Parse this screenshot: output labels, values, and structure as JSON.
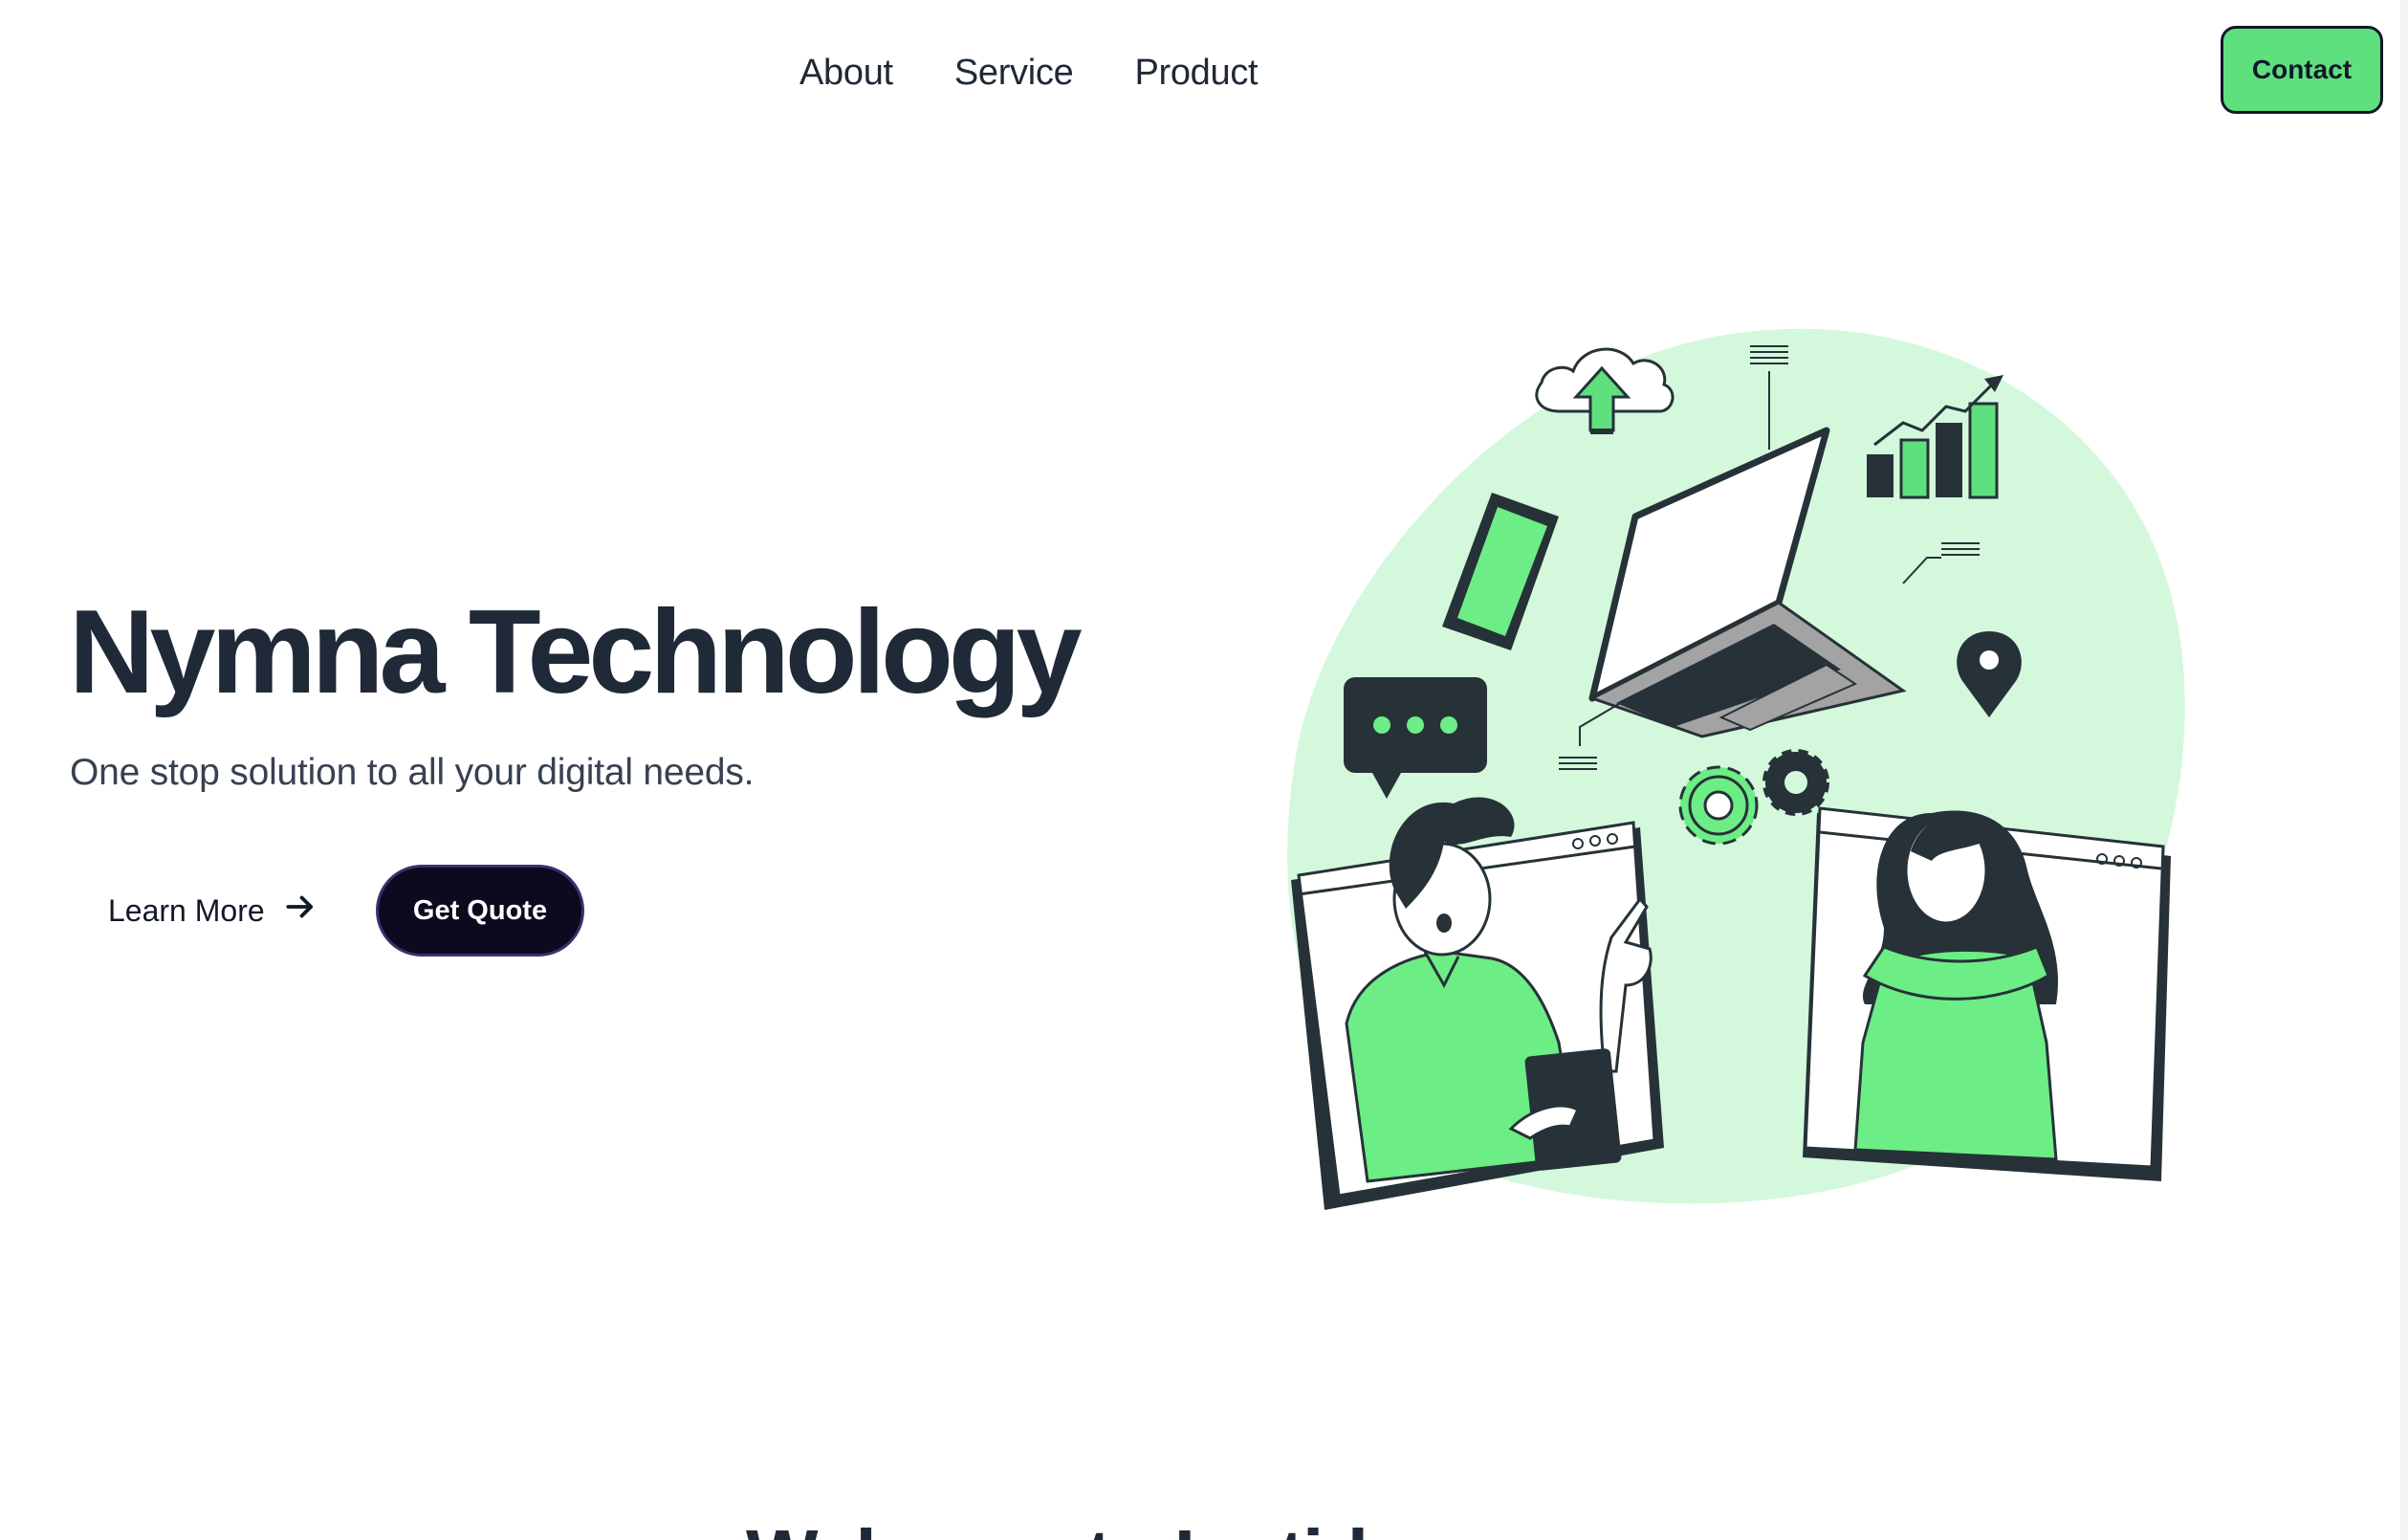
{
  "nav": {
    "links": [
      "About",
      "Service",
      "Product"
    ],
    "contact_label": "Contact"
  },
  "hero": {
    "title": "Nymna Technology",
    "subtitle": "One stop solution to all your digital needs.",
    "learn_more_label": "Learn More",
    "get_quote_label": "Get Quote"
  },
  "next_section": {
    "heading": "Welcome to Instide"
  },
  "colors": {
    "accent_green": "#5fe07f",
    "blob_green": "#d4f8dc",
    "dark": "#1f2937",
    "button_dark": "#0b0a1f"
  },
  "icons": [
    "arrow-right-icon"
  ]
}
